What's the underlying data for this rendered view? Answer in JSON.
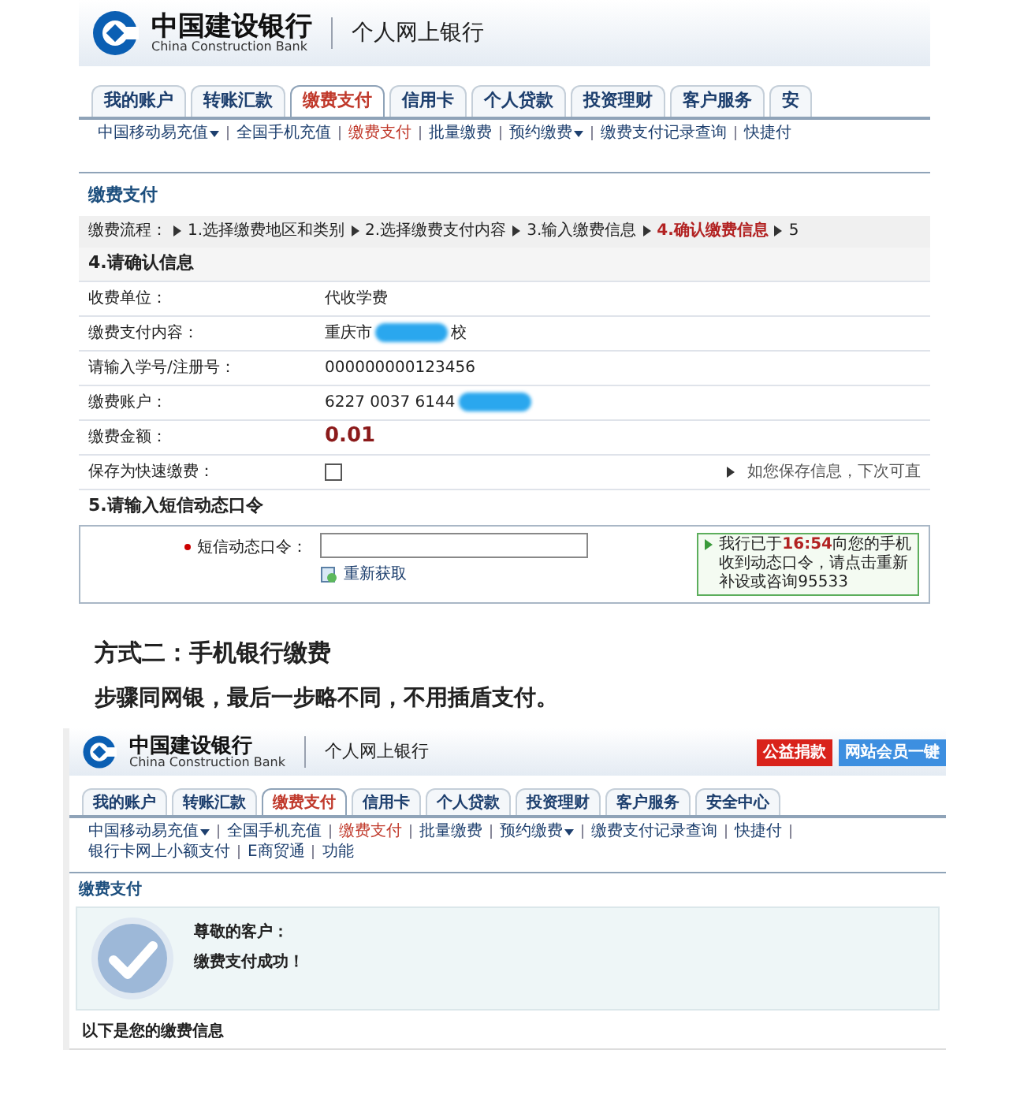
{
  "shot1": {
    "logo": {
      "name_cn": "中国建设银行",
      "name_en": "China Construction Bank",
      "product": "个人网上银行"
    },
    "tabs": [
      {
        "label": "我的账户",
        "selected": false
      },
      {
        "label": "转账汇款",
        "selected": false
      },
      {
        "label": "缴费支付",
        "selected": true
      },
      {
        "label": "信用卡",
        "selected": false
      },
      {
        "label": "个人贷款",
        "selected": false
      },
      {
        "label": "投资理财",
        "selected": false
      },
      {
        "label": "客户服务",
        "selected": false
      },
      {
        "label": "安",
        "selected": false
      }
    ],
    "subnav": [
      {
        "label": "中国移动易充值",
        "selected": false,
        "dropdown": true
      },
      {
        "label": "全国手机充值",
        "selected": false,
        "dropdown": false
      },
      {
        "label": "缴费支付",
        "selected": true,
        "dropdown": false
      },
      {
        "label": "批量缴费",
        "selected": false,
        "dropdown": false
      },
      {
        "label": "预约缴费",
        "selected": false,
        "dropdown": true
      },
      {
        "label": "缴费支付记录查询",
        "selected": false,
        "dropdown": false
      },
      {
        "label": "快捷付",
        "selected": false,
        "dropdown": false
      }
    ],
    "page_title": "缴费支付",
    "steps": {
      "label": "缴费流程：",
      "items": [
        {
          "label": "1.选择缴费地区和类别",
          "selected": false
        },
        {
          "label": "2.选择缴费支付内容",
          "selected": false
        },
        {
          "label": "3.输入缴费信息",
          "selected": false
        },
        {
          "label": "4.确认缴费信息",
          "selected": true
        },
        {
          "label": "5",
          "selected": false
        }
      ]
    },
    "confirm": {
      "heading": "4.请确认信息",
      "rows": [
        {
          "kind": "text",
          "label": "收费单位：",
          "value": "代收学费"
        },
        {
          "kind": "masked",
          "label": "缴费支付内容：",
          "value": "重庆市",
          "tail": "校"
        },
        {
          "kind": "text",
          "label": "请输入学号/注册号：",
          "value": "000000000123456"
        },
        {
          "kind": "masked",
          "label": "缴费账户：",
          "value": "6227 0037 6144"
        },
        {
          "kind": "amount",
          "label": "缴费金额：",
          "value": "0.01"
        },
        {
          "kind": "checkbox",
          "label": "保存为快速缴费：",
          "checked": false,
          "hint": "如您保存信息，下次可直"
        }
      ]
    },
    "otp": {
      "heading": "5.请输入短信动态口令",
      "label": "短信动态口令：",
      "refresh": "重新获取",
      "tip": [
        "我行已于**16:54**向您的手机",
        "收到动态口令，请点击重新",
        "补设或咨询95533"
      ]
    }
  },
  "method": {
    "title": "方式二：手机银行缴费",
    "desc": "步骤同网银，最后一步略不同，不用插盾支付。"
  },
  "shot2": {
    "logo": {
      "name_cn": "中国建设银行",
      "name_en": "China Construction Bank",
      "product": "个人网上银行"
    },
    "badges": [
      "公益捐款",
      "网站会员一键"
    ],
    "tabs": [
      {
        "label": "我的账户",
        "selected": false
      },
      {
        "label": "转账汇款",
        "selected": false
      },
      {
        "label": "缴费支付",
        "selected": true
      },
      {
        "label": "信用卡",
        "selected": false
      },
      {
        "label": "个人贷款",
        "selected": false
      },
      {
        "label": "投资理财",
        "selected": false
      },
      {
        "label": "客户服务",
        "selected": false
      },
      {
        "label": "安全中心",
        "selected": false
      }
    ],
    "subnav": [
      {
        "label": "中国移动易充值",
        "selected": false,
        "dropdown": true
      },
      {
        "label": "全国手机充值",
        "selected": false,
        "dropdown": false
      },
      {
        "label": "缴费支付",
        "selected": true,
        "dropdown": false
      },
      {
        "label": "批量缴费",
        "selected": false,
        "dropdown": false
      },
      {
        "label": "预约缴费",
        "selected": false,
        "dropdown": true
      },
      {
        "label": "缴费支付记录查询",
        "selected": false,
        "dropdown": false
      },
      {
        "label": "快捷付",
        "selected": false,
        "dropdown": false
      },
      {
        "label": "银行卡网上小额支付",
        "selected": false,
        "dropdown": false
      },
      {
        "label": "E商贸通",
        "selected": false,
        "dropdown": false
      },
      {
        "label": "功能",
        "selected": false,
        "dropdown": false
      }
    ],
    "page_title": "缴费支付",
    "success": [
      "尊敬的客户：",
      "缴费支付成功！"
    ],
    "info_heading": "以下是您的缴费信息"
  }
}
